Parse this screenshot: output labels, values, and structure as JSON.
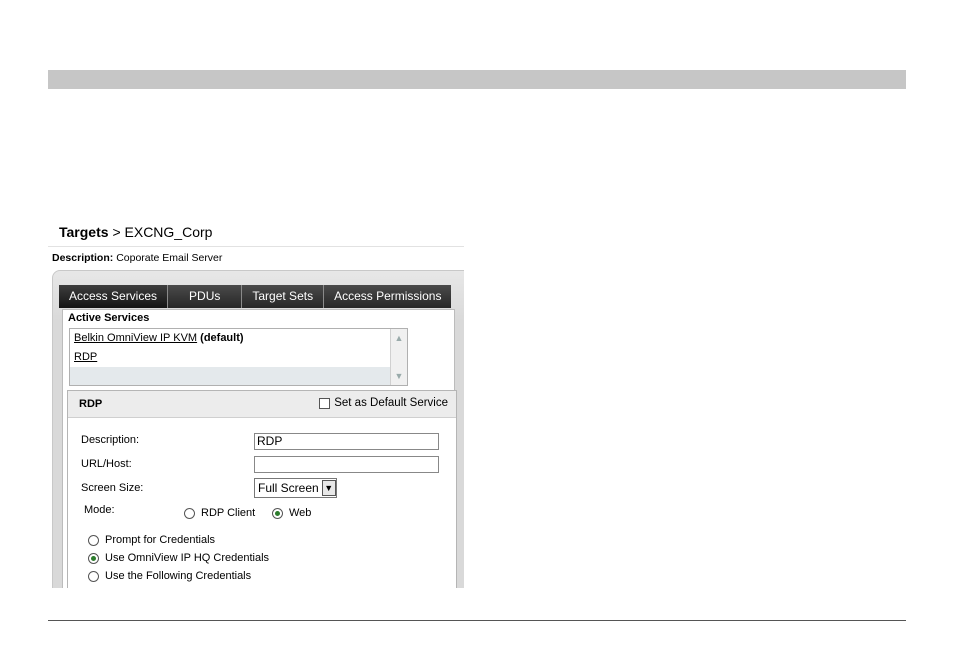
{
  "breadcrumb": {
    "root": "Targets",
    "separator": ">",
    "current": "EXCNG_Corp"
  },
  "description": {
    "label": "Description:",
    "value": "Coporate Email Server"
  },
  "tabs": [
    {
      "label": "Access Services",
      "active": true
    },
    {
      "label": "PDUs",
      "active": false
    },
    {
      "label": "Target Sets",
      "active": false
    },
    {
      "label": "Access Permissions",
      "active": false
    }
  ],
  "active_services": {
    "title": "Active Services",
    "items": [
      {
        "name": "Belkin OmniView IP KVM",
        "tag": "(default)"
      },
      {
        "name": "RDP",
        "tag": ""
      }
    ]
  },
  "rdp": {
    "title": "RDP",
    "default_label": "Set as Default Service",
    "description_label": "Description:",
    "description_value": "RDP",
    "url_label": "URL/Host:",
    "url_value": "",
    "screen_size_label": "Screen Size:",
    "screen_size_value": "Full Screen",
    "mode_label": "Mode:",
    "mode_options": [
      "RDP Client",
      "Web"
    ],
    "credential_options": [
      "Prompt for Credentials",
      "Use OmniView IP HQ Credentials",
      "Use the Following Credentials"
    ]
  },
  "colors": {
    "tab_bg": "#262626",
    "radio_on": "#2d7d2d",
    "top_bar": "#c6c6c6"
  }
}
